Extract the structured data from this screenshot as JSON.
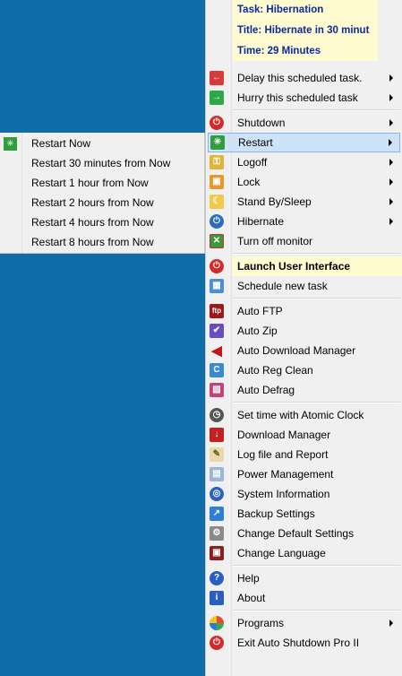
{
  "info": {
    "task": "Task: Hibernation",
    "title": "Title: Hibernate in 30 minut",
    "time": "Time:  29 Minutes"
  },
  "menu_items": [
    {
      "label": "Delay this scheduled task.",
      "icon": "delay-icon",
      "submenu": true
    },
    {
      "label": "Hurry this scheduled task",
      "icon": "hurry-icon",
      "submenu": true
    },
    {
      "label": "Shutdown",
      "icon": "shutdown-icon",
      "submenu": true
    },
    {
      "label": "Restart",
      "icon": "restart-icon",
      "submenu": true,
      "highlighted": true
    },
    {
      "label": "Logoff",
      "icon": "key-icon",
      "submenu": true
    },
    {
      "label": "Lock",
      "icon": "lock-icon",
      "submenu": true
    },
    {
      "label": "Stand By/Sleep",
      "icon": "sleep-icon",
      "submenu": true
    },
    {
      "label": "Hibernate",
      "icon": "power-icon",
      "submenu": true
    },
    {
      "label": "Turn off monitor",
      "icon": "monitor-off-icon",
      "submenu": false
    },
    {
      "label": "Launch User Interface",
      "icon": "launch-icon",
      "submenu": false
    },
    {
      "label": "Schedule new task",
      "icon": "schedule-icon",
      "submenu": false
    },
    {
      "label": "Auto FTP",
      "icon": "ftp-icon",
      "submenu": false
    },
    {
      "label": "Auto Zip",
      "icon": "zip-icon",
      "submenu": false
    },
    {
      "label": "Auto Download Manager",
      "icon": "download-arrow-icon",
      "submenu": false
    },
    {
      "label": "Auto Reg Clean",
      "icon": "reg-clean-icon",
      "submenu": false
    },
    {
      "label": "Auto Defrag",
      "icon": "defrag-icon",
      "submenu": false
    },
    {
      "label": "Set time with Atomic Clock",
      "icon": "clock-icon",
      "submenu": false
    },
    {
      "label": "Download Manager",
      "icon": "download-icon",
      "submenu": false
    },
    {
      "label": "Log file and Report",
      "icon": "log-icon",
      "submenu": false
    },
    {
      "label": "Power Management",
      "icon": "power-management-icon",
      "submenu": false
    },
    {
      "label": "System Information",
      "icon": "system-info-icon",
      "submenu": false
    },
    {
      "label": "Backup Settings",
      "icon": "backup-icon",
      "submenu": false
    },
    {
      "label": "Change Default Settings",
      "icon": "gear-icon",
      "submenu": false
    },
    {
      "label": "Change Language",
      "icon": "language-icon",
      "submenu": false
    },
    {
      "label": "Help",
      "icon": "help-icon",
      "submenu": false
    },
    {
      "label": "About",
      "icon": "about-icon",
      "submenu": false
    },
    {
      "label": "Programs",
      "icon": "programs-icon",
      "submenu": true
    },
    {
      "label": "Exit Auto Shutdown Pro II",
      "icon": "exit-icon",
      "submenu": false
    }
  ],
  "restart_submenu": [
    {
      "label": "Restart Now",
      "icon": "restart-icon"
    },
    {
      "label": "Restart 30 minutes from Now"
    },
    {
      "label": "Restart 1 hour from Now"
    },
    {
      "label": "Restart 2 hours from Now"
    },
    {
      "label": "Restart 4 hours from Now"
    },
    {
      "label": "Restart 8 hours from Now"
    }
  ],
  "colors": {
    "desktop": "#0f6ea7",
    "menu_bg": "#f0f0f0",
    "highlight": "#cfe3f8",
    "info_bg": "#fffbd1",
    "info_text": "#0b2a9e"
  }
}
